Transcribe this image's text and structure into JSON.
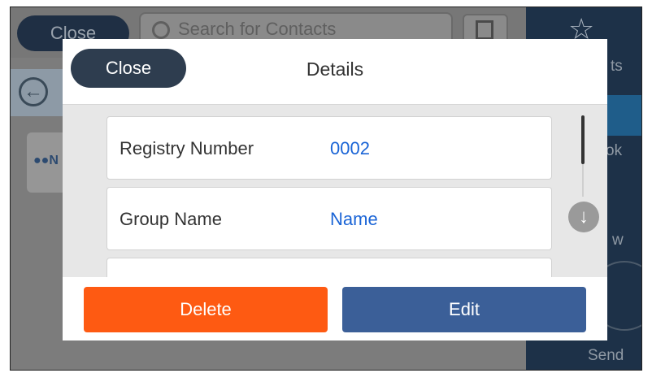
{
  "background": {
    "close_label": "Close",
    "search_placeholder": "Search for Contacts",
    "tile_label": "N",
    "right_panel": {
      "label_1": "ts",
      "label_2": "ok",
      "label_3": "w",
      "send_label": "Send"
    }
  },
  "modal": {
    "title": "Details",
    "close_label": "Close",
    "rows": [
      {
        "label": "Registry Number",
        "value": "0002"
      },
      {
        "label": "Group Name",
        "value": "Name"
      }
    ],
    "delete_label": "Delete",
    "edit_label": "Edit"
  },
  "icons": {
    "search": "magnifier",
    "contacts": "contact-card",
    "back": "arrow-left-circle",
    "group": "people",
    "favorite": "star-outline",
    "scroll_down": "arrow-down-circle"
  },
  "colors": {
    "delete_button": "#fe5a12",
    "edit_button": "#3b5f98",
    "close_button": "#2e3d4f",
    "value_text": "#1a64d6"
  }
}
